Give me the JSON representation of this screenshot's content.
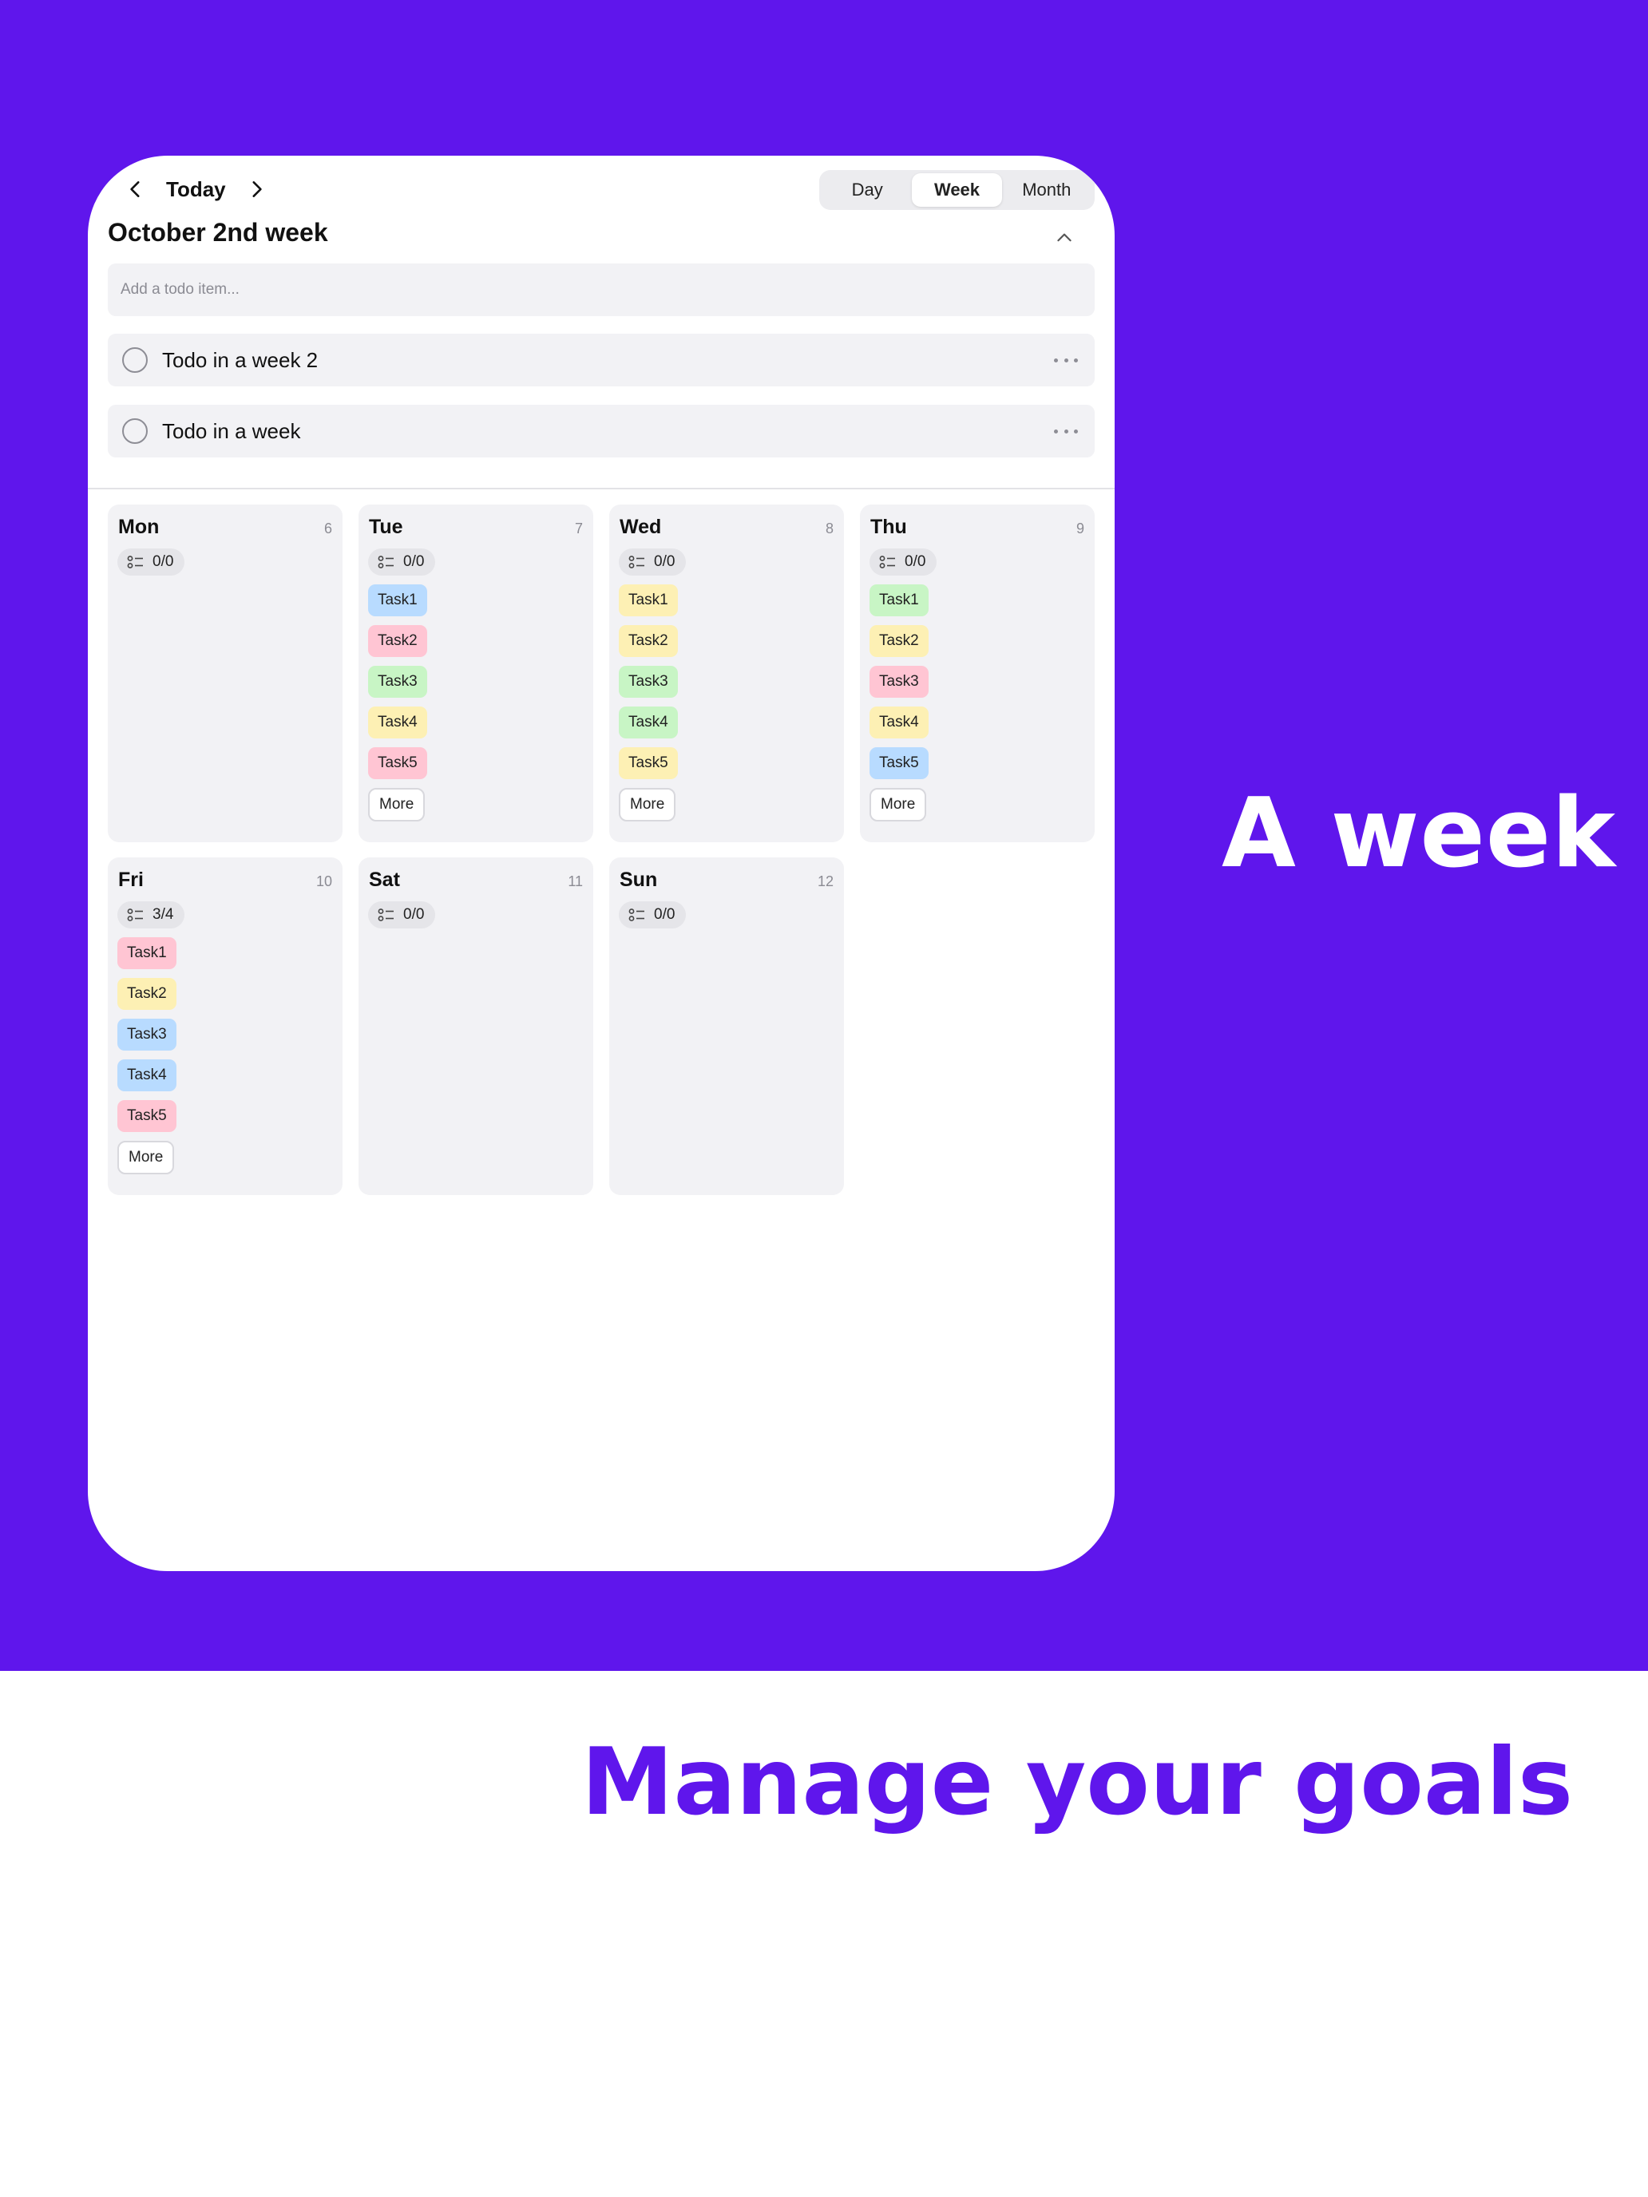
{
  "marketing": {
    "tagline": "A week",
    "headline": "Manage your goals",
    "brand_color": "#5f16ec"
  },
  "header": {
    "prev_icon": "chevron-left-icon",
    "today_label": "Today",
    "next_icon": "chevron-right-icon",
    "view_tabs": [
      {
        "label": "Day",
        "active": false
      },
      {
        "label": "Week",
        "active": true
      },
      {
        "label": "Month",
        "active": false
      }
    ],
    "week_title": "October 2nd week",
    "collapse_icon": "chevron-up-icon"
  },
  "add_todo": {
    "placeholder": "Add a todo item..."
  },
  "todos": [
    {
      "label": "Todo in a week 2",
      "done": false
    },
    {
      "label": "Todo in a week",
      "done": false
    }
  ],
  "more_label": "More",
  "days": [
    {
      "name": "Mon",
      "date": "6",
      "progress": "0/0",
      "tasks": [],
      "show_more": false
    },
    {
      "name": "Tue",
      "date": "7",
      "progress": "0/0",
      "tasks": [
        {
          "label": "Task1",
          "color": "blue"
        },
        {
          "label": "Task2",
          "color": "pink"
        },
        {
          "label": "Task3",
          "color": "green"
        },
        {
          "label": "Task4",
          "color": "yellow"
        },
        {
          "label": "Task5",
          "color": "pink"
        }
      ],
      "show_more": true
    },
    {
      "name": "Wed",
      "date": "8",
      "progress": "0/0",
      "tasks": [
        {
          "label": "Task1",
          "color": "yellow"
        },
        {
          "label": "Task2",
          "color": "yellow"
        },
        {
          "label": "Task3",
          "color": "green"
        },
        {
          "label": "Task4",
          "color": "green"
        },
        {
          "label": "Task5",
          "color": "yellow"
        }
      ],
      "show_more": true
    },
    {
      "name": "Thu",
      "date": "9",
      "progress": "0/0",
      "tasks": [
        {
          "label": "Task1",
          "color": "green"
        },
        {
          "label": "Task2",
          "color": "yellow"
        },
        {
          "label": "Task3",
          "color": "pink"
        },
        {
          "label": "Task4",
          "color": "yellow"
        },
        {
          "label": "Task5",
          "color": "blue"
        }
      ],
      "show_more": true
    },
    {
      "name": "Fri",
      "date": "10",
      "progress": "3/4",
      "tasks": [
        {
          "label": "Task1",
          "color": "pink"
        },
        {
          "label": "Task2",
          "color": "yellow"
        },
        {
          "label": "Task3",
          "color": "blue"
        },
        {
          "label": "Task4",
          "color": "blue"
        },
        {
          "label": "Task5",
          "color": "pink"
        }
      ],
      "show_more": true
    },
    {
      "name": "Sat",
      "date": "11",
      "progress": "0/0",
      "tasks": [],
      "show_more": false
    },
    {
      "name": "Sun",
      "date": "12",
      "progress": "0/0",
      "tasks": [],
      "show_more": false
    }
  ]
}
